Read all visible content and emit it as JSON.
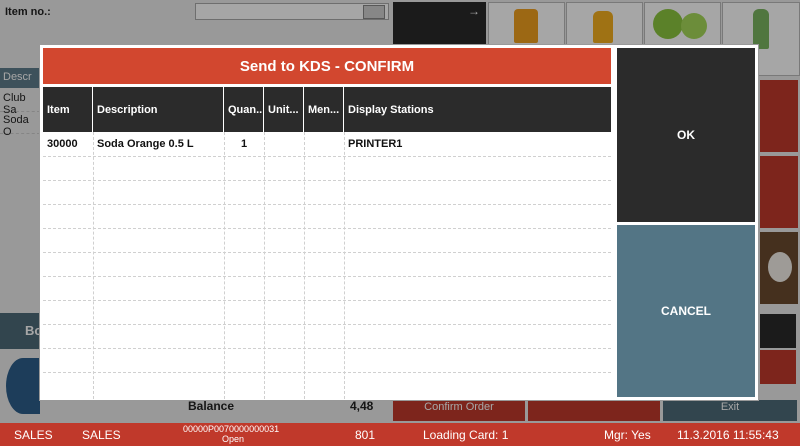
{
  "background": {
    "item_no_label": "Item no.:",
    "description_header": "Descr",
    "list_items": [
      "Club Sa",
      "Soda O"
    ],
    "balance_label": "Balance",
    "balance_value": "4,48",
    "bottom_left_button": "Bo",
    "confirm_order_button": "Confirm Order",
    "exit_button": "Exit"
  },
  "statusbar": {
    "mode1": "SALES",
    "mode2": "SALES",
    "receipt_no": "00000P0070000000031",
    "receipt_state": "Open",
    "terminal": "801",
    "loading_card": "Loading Card: 1",
    "manager": "Mgr: Yes",
    "datetime": "11.3.2016 11:55:43"
  },
  "dialog": {
    "title": "Send to KDS - CONFIRM",
    "columns": [
      "Item",
      "Description",
      "Quan...",
      "Unit...",
      "Men...",
      "Display Stations"
    ],
    "rows": [
      {
        "item": "30000",
        "description": "Soda Orange 0.5 L",
        "quantity": "1",
        "unit": "",
        "menu": "",
        "stations": "PRINTER1"
      }
    ],
    "ok_label": "OK",
    "cancel_label": "CANCEL"
  },
  "colors": {
    "title_red": "#d2472f",
    "header_dark": "#2b2b2b",
    "cancel_teal": "#537585",
    "status_red": "#c0392b"
  }
}
